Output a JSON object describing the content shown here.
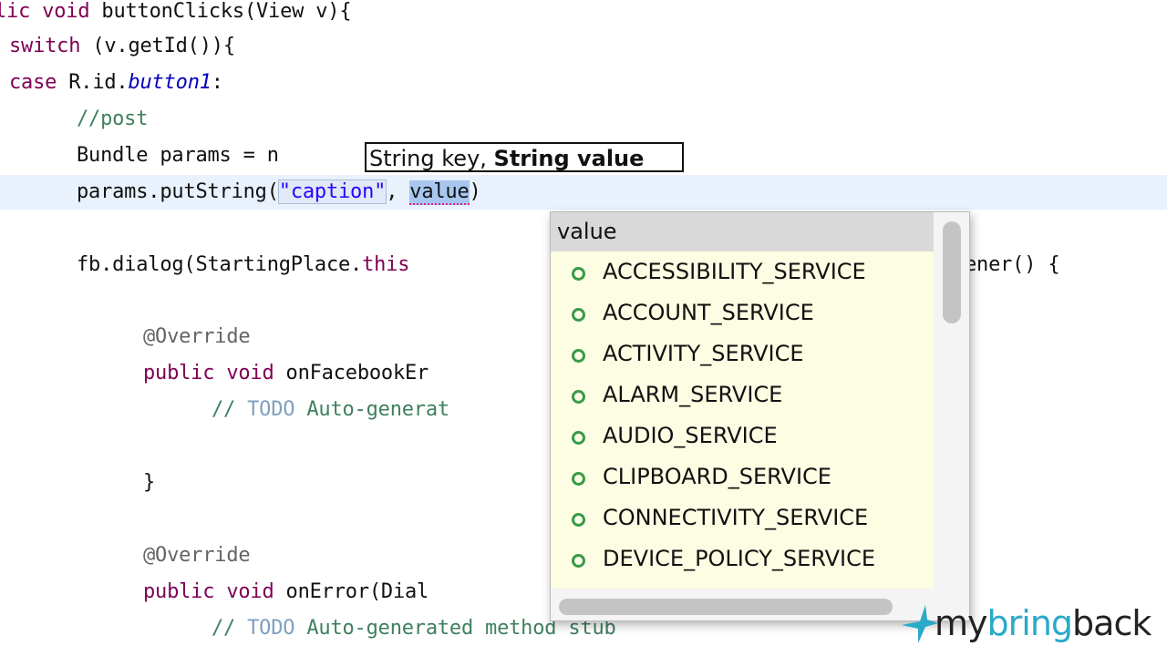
{
  "editor": {
    "lines": [
      {
        "parts": [
          "lic void",
          " buttonClicks(View v){"
        ]
      },
      {
        "parts": [
          "switch",
          " (v.getId()){"
        ]
      },
      {
        "parts": [
          "case",
          " R.id.",
          "button1",
          ":"
        ]
      },
      {
        "parts": [
          "//post"
        ]
      },
      {
        "parts": [
          "Bundle params = n"
        ]
      },
      {
        "parts": [
          "params.putString(",
          "\"caption\"",
          ", ",
          "value",
          ")"
        ]
      },
      {
        "parts": [
          "fb.dialog(StartingPlace.",
          "this",
          "ener() {"
        ]
      },
      {
        "parts": [
          "@Override"
        ]
      },
      {
        "parts": [
          "public void",
          " onFacebookEr"
        ]
      },
      {
        "parts": [
          "// ",
          "TODO",
          " Auto-generat"
        ]
      },
      {
        "parts": [
          "}"
        ]
      },
      {
        "parts": [
          "@Override"
        ]
      },
      {
        "parts": [
          "public void",
          " onError(Dial"
        ]
      },
      {
        "parts": [
          "// ",
          "TODO",
          " Auto-generated method stub"
        ]
      }
    ]
  },
  "tooltip": {
    "part1": "String key, ",
    "part2": "String value"
  },
  "autocomplete": {
    "header": "value",
    "items": [
      "ACCESSIBILITY_SERVICE",
      "ACCOUNT_SERVICE",
      "ACTIVITY_SERVICE",
      "ALARM_SERVICE",
      "AUDIO_SERVICE",
      "CLIPBOARD_SERVICE",
      "CONNECTIVITY_SERVICE",
      "DEVICE_POLICY_SERVICE"
    ]
  },
  "watermark": {
    "my": "my",
    "bring": "bring",
    "back": "back"
  },
  "colors": {
    "keyword": "#7f0055",
    "comment": "#3f7f5f",
    "string": "#2a00ff",
    "field": "#0000c0",
    "popup_bg": "#fdfde3",
    "logo_accent": "#2aa9c9"
  }
}
